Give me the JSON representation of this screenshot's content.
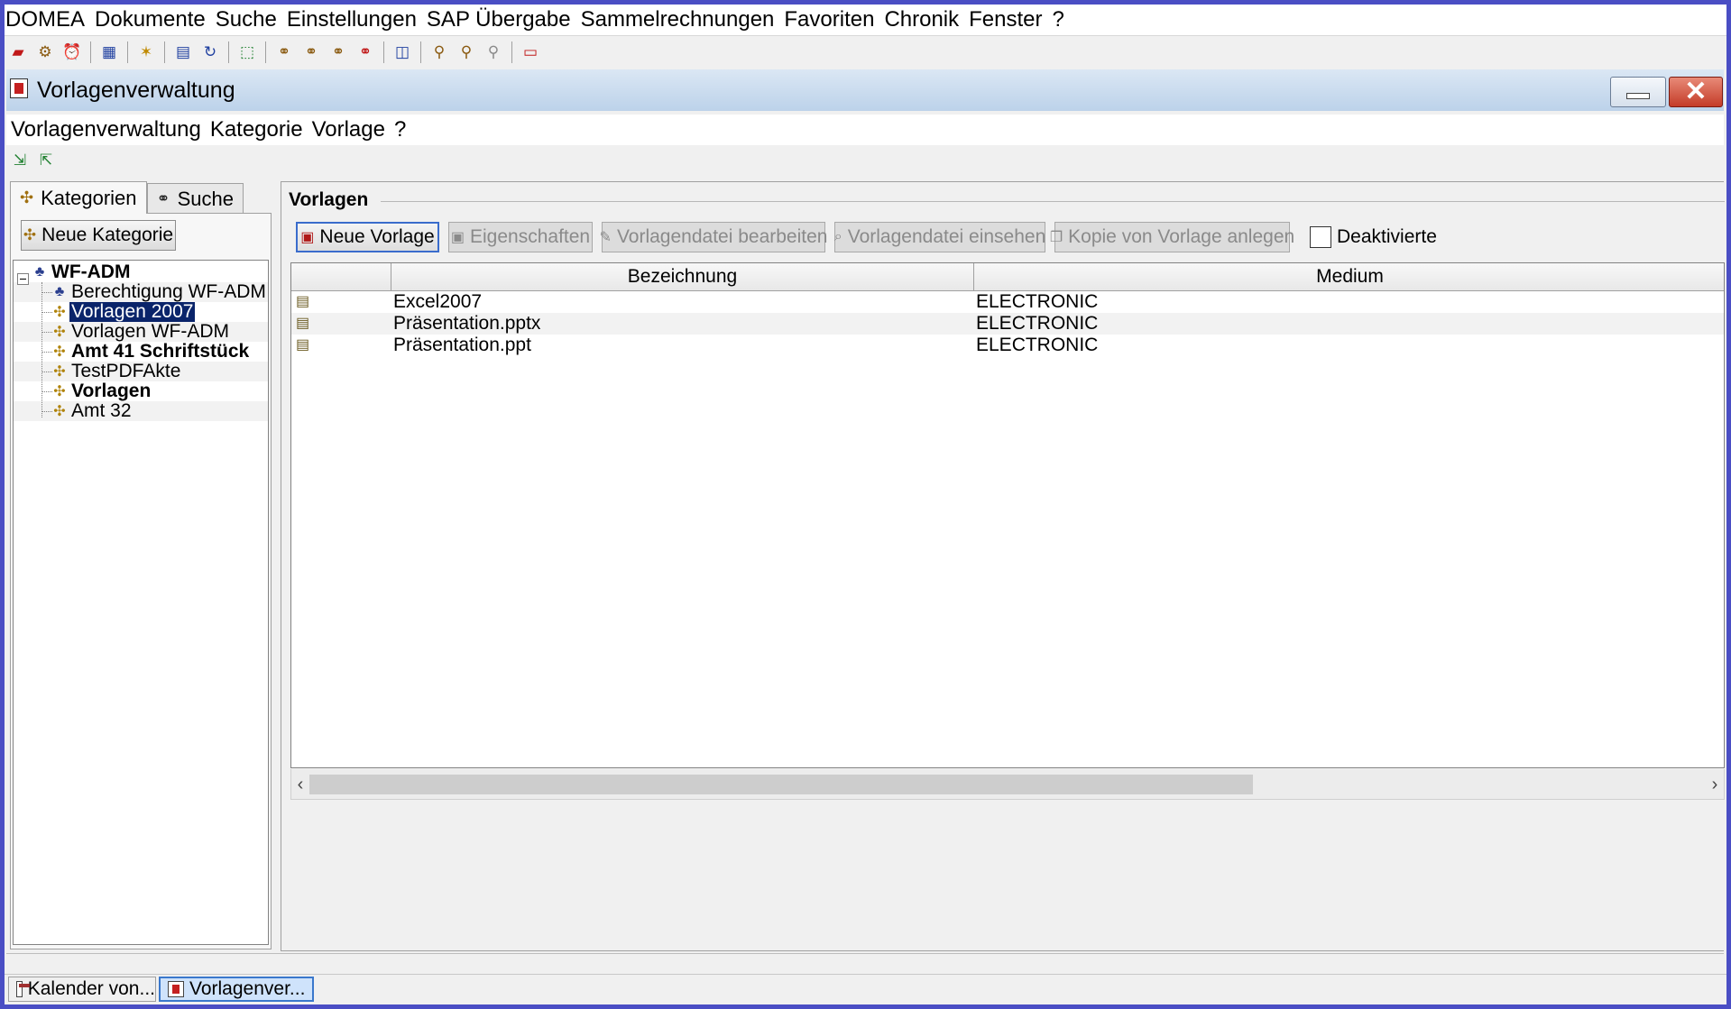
{
  "main_menu": [
    "DOMEA",
    "Dokumente",
    "Suche",
    "Einstellungen",
    "SAP Übergabe",
    "Sammelrechnungen",
    "Favoriten",
    "Chronik",
    "Fenster",
    "?"
  ],
  "window": {
    "title": "Vorlagenverwaltung",
    "menu": [
      "Vorlagenverwaltung",
      "Kategorie",
      "Vorlage",
      "?"
    ],
    "close_glyph": "✕"
  },
  "left": {
    "tabs": {
      "kategorien": "Kategorien",
      "suche": "Suche"
    },
    "new_category_label": "Neue Kategorie",
    "tree": {
      "root": "WF-ADM",
      "children": [
        "Berechtigung WF-ADM",
        "Vorlagen 2007",
        "Vorlagen WF-ADM",
        "Amt 41 Schriftstück",
        "TestPDFAkte",
        "Vorlagen",
        "Amt 32"
      ],
      "selected": "Vorlagen 2007"
    }
  },
  "right": {
    "group_title": "Vorlagen",
    "buttons": {
      "new": "Neue Vorlage",
      "properties": "Eigenschaften",
      "edit_file": "Vorlagendatei bearbeiten",
      "view_file": "Vorlagendatei einsehen",
      "copy": "Kopie von Vorlage anlegen"
    },
    "deactivated_label": "Deaktivierte",
    "deactivated_checked": false,
    "columns": [
      "",
      "Bezeichnung",
      "Medium"
    ],
    "rows": [
      {
        "name": "Excel2007",
        "medium": "ELECTRONIC"
      },
      {
        "name": "Präsentation.pptx",
        "medium": "ELECTRONIC"
      },
      {
        "name": "Präsentation.ppt",
        "medium": "ELECTRONIC"
      }
    ]
  },
  "taskbar": [
    "Kalender von...",
    "Vorlagenver..."
  ],
  "colors": {
    "selection": "#0a246a",
    "frame": "#4a4ec4",
    "title_gradient": "#bcd2ea"
  }
}
